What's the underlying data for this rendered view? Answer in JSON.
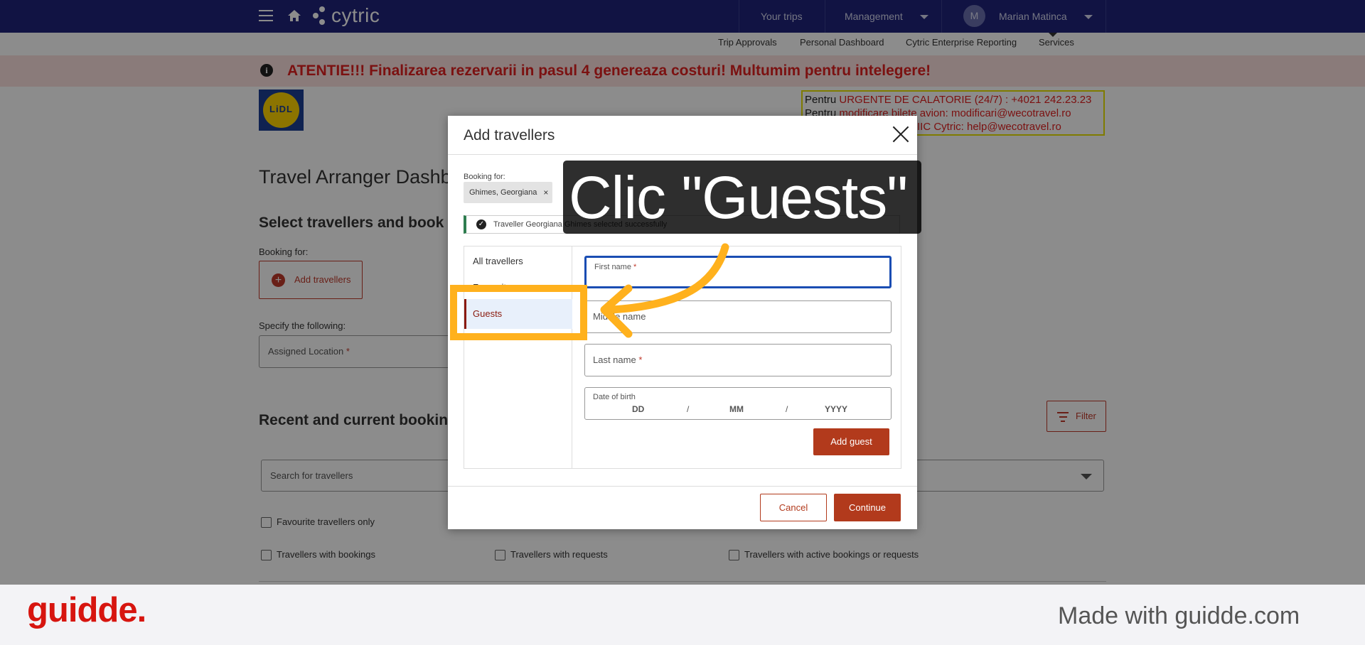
{
  "topbar": {
    "app_name": "cytric",
    "your_trips": "Your trips",
    "management": "Management",
    "avatar_initial": "M",
    "user_name": "Marian Matinca"
  },
  "subnav": {
    "trip_approvals": "Trip Approvals",
    "personal_dashboard": "Personal Dashboard",
    "enterprise_reporting": "Cytric Enterprise Reporting",
    "services": "Services"
  },
  "alert": {
    "text": "ATENTIE!!! Finalizarea rezervarii in pasul 4 genereaza costuri! Multumim pentru intelegere!"
  },
  "logo_text": "LiDL",
  "contact": {
    "line1_prefix": "Pentru ",
    "line1_red": "URGENTE DE CALATORIE (24/7) : +4021 242.23.23",
    "line2_prefix": "Pentru ",
    "line2_red": "modificare bilete avion:  modificari@wecotravel.ro",
    "line3": "IIC Cytric:  help@wecotravel.ro"
  },
  "page": {
    "title": "Travel Arranger Dashb",
    "select_title": "Select travellers and book",
    "booking_for": "Booking for:",
    "add_travellers": "Add travellers",
    "specify": "Specify the following:",
    "assigned_location": "Assigned Location",
    "required_mark": "*",
    "recent_title": "Recent and current booking",
    "search_placeholder": "Search for travellers",
    "filter": "Filter",
    "fav_only": "Favourite travellers only",
    "with_bookings": "Travellers with bookings",
    "with_requests": "Travellers with requests",
    "with_active": "Travellers with active bookings or requests"
  },
  "modal": {
    "title": "Add travellers",
    "booking_for": "Booking for:",
    "chip": "Ghimes, Georgiana",
    "chip_remove": "×",
    "success": "Traveller Georgiana Ghimes selected successfully",
    "tabs": [
      "All travellers",
      "Favourites",
      "Guests"
    ],
    "first_name": "First name",
    "middle_name": "Middle name",
    "last_name": "Last name",
    "dob_label": "Date of birth",
    "dob_dd": "DD",
    "dob_mm": "MM",
    "dob_yyyy": "YYYY",
    "dob_sep": "/",
    "required_mark": "*",
    "add_guest": "Add guest",
    "cancel": "Cancel",
    "continue": "Continue"
  },
  "annotation": {
    "callout": "Clic \"Guests\""
  },
  "footer": {
    "brand": "guidde.",
    "made_with": "Made with guidde.com"
  },
  "colors": {
    "navbar": "#1f237a",
    "alert_bg": "#fbe1df",
    "alert_text": "#e0201f",
    "accent_red": "#b23a1c",
    "highlight": "#ffb11d",
    "guidde_red": "#d7150f"
  }
}
